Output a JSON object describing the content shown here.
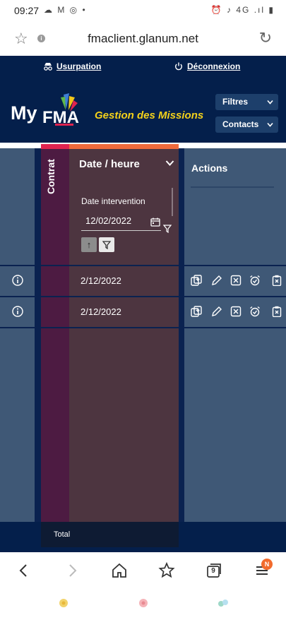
{
  "status_bar": {
    "time": "09:27",
    "left_icons": "☁ M ◎ •",
    "right_icons": "⏰ ♪ 4G .ıl ▮"
  },
  "browser": {
    "url": "fmaclient.glanum.net",
    "tab_count": "9",
    "menu_badge": "N"
  },
  "app": {
    "usurpation_label": "Usurpation",
    "logout_label": "Déconnexion",
    "logo_text": "My",
    "brand_title": "Gestion des Missions",
    "filters_label": "Filtres",
    "contacts_label": "Contacts"
  },
  "table": {
    "contrat_header": "Contrat",
    "date_header": "Date / heure",
    "actions_header": "Actions",
    "filter_label": "Date intervention",
    "filter_value": "12/02/2022",
    "rows": [
      {
        "date": "2/12/2022"
      },
      {
        "date": "2/12/2022"
      }
    ],
    "total_label": "Total"
  },
  "colors": {
    "header_bg": "#041f4b",
    "side_col": "#3f5876",
    "contrat_col": "#4d1b42",
    "date_col": "#4d3540",
    "contrat_accent": "#e0234f",
    "date_accent": "#ef6a3b",
    "brand_yellow": "#f4d11a"
  }
}
